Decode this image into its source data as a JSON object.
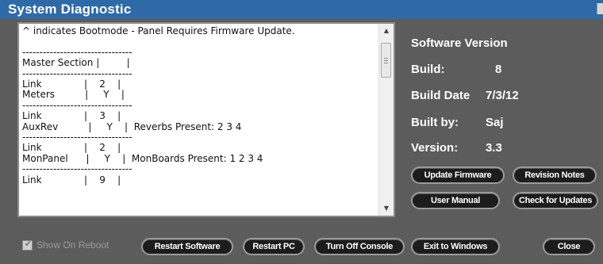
{
  "window": {
    "title": "System Diagnostic"
  },
  "log": {
    "text": "^ indicates Bootmode - Panel Requires Firmware Update.\n\n--------------------------------\nMaster Section |         |\n--------------------------------\nLink              |    2    |\nMeters          |     Y    |\n--------------------------------\nLink              |    3    |\nAuxRev          |     Y    |  Reverbs Present: 2 3 4\n--------------------------------\nLink              |    2    |\nMonPanel      |     Y    |  MonBoards Present: 1 2 3 4\n--------------------------------\nLink              |    9    |"
  },
  "info": {
    "heading": "Software Version",
    "build_label": "Build:",
    "build_value": "8",
    "build_date_label": "Build Date",
    "build_date_value": "7/3/12",
    "built_by_label": "Built by:",
    "built_by_value": "Saj",
    "version_label": "Version:",
    "version_value": "3.3"
  },
  "buttons": {
    "update_firmware": "Update Firmware",
    "revision_notes": "Revision Notes",
    "user_manual": "User Manual",
    "check_updates": "Check for Updates",
    "restart_software": "Restart Software",
    "restart_pc": "Restart PC",
    "turn_off_console": "Turn Off Console",
    "exit_windows": "Exit to Windows",
    "close": "Close"
  },
  "show_on_reboot": {
    "label": "Show On Reboot",
    "checked": true
  },
  "icons": {
    "scroll_up": "triangle-up-icon",
    "scroll_down": "triangle-down-icon",
    "check": "checkmark-icon"
  }
}
